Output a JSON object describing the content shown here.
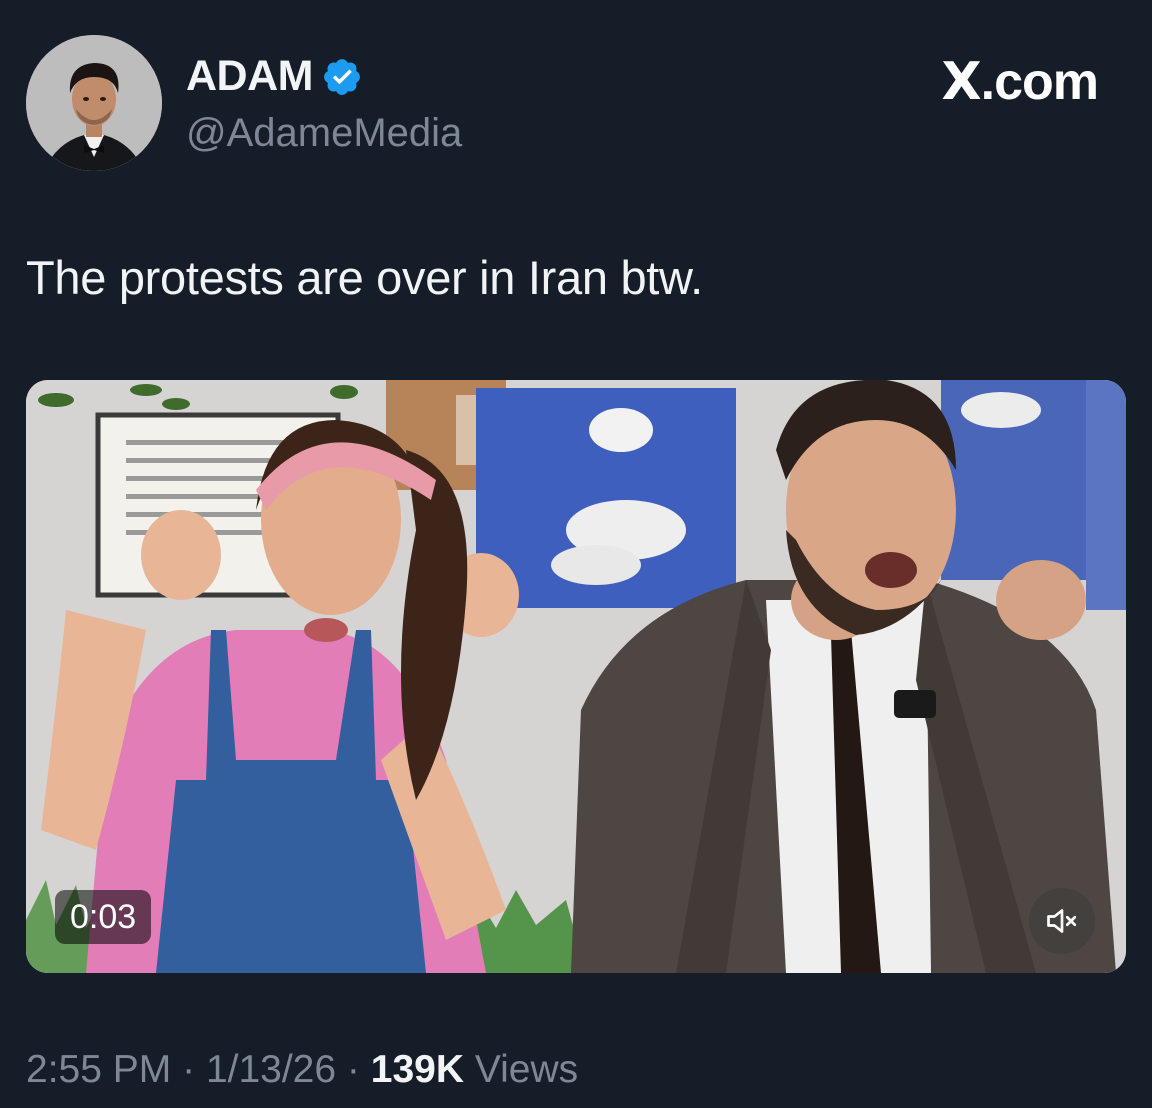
{
  "author": {
    "display_name": "ADAM",
    "handle": "@AdameMedia",
    "verified": true,
    "avatar_icon": "profile-photo"
  },
  "brand": {
    "label": ".com",
    "glyph": "X"
  },
  "tweet": {
    "text": "The protests are over in Iran btw."
  },
  "video": {
    "duration": "0:03",
    "muted_icon": "speaker-muted-icon"
  },
  "footer": {
    "time": "2:55 PM",
    "separator": "·",
    "date": "1/13/26",
    "views_count": "139K",
    "views_label": "Views"
  },
  "colors": {
    "background": "#151d29",
    "verified_badge": "#1d9bf0",
    "secondary_text": "#7d8894",
    "primary_text": "#f1f3f4"
  }
}
